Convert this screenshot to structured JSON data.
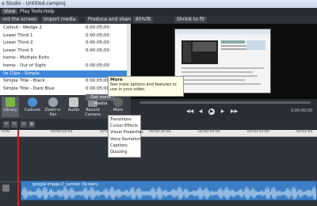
{
  "window": {
    "title": "a Studio - Untitled.camproj"
  },
  "menu": {
    "items": [
      "View",
      "Play",
      "Tools",
      "Help"
    ],
    "active_index": 0
  },
  "toolbar": {
    "record_label": "ord the screen",
    "import_label": "Import media",
    "produce_label": "Produce and share",
    "zoom_label": "85%fit",
    "size_label": "Shrink to fit"
  },
  "clips": [
    {
      "label": "Callout - Wedge 2",
      "duration": "0:00:05;00",
      "selected": false
    },
    {
      "label": "Lower Third 1",
      "duration": "0:00:05;00",
      "selected": false
    },
    {
      "label": "Lower Third 2",
      "duration": "0:00:05;00",
      "selected": false
    },
    {
      "label": "Lower Third 3",
      "duration": "0:00:05;00",
      "selected": false
    },
    {
      "label": "heme - Multiple Exits",
      "duration": "",
      "selected": false
    },
    {
      "label": "heme - Out of Sight",
      "duration": "0:00:05;00",
      "selected": false
    },
    {
      "label": "ile Clips - Simple",
      "duration": "",
      "selected": true
    },
    {
      "label": "Simple Title - Black",
      "duration": "0:00:05;00",
      "selected": false
    },
    {
      "label": "Simple Title - Dark Blue",
      "duration": "0:00:05;00",
      "selected": false
    }
  ],
  "clip_header": "",
  "tooltip": {
    "title": "More",
    "body": "See more options and features to use in your video."
  },
  "get_media_label": "Get more media",
  "tasks": [
    {
      "label": "Library",
      "icon": "library-icon",
      "selected": true
    },
    {
      "label": "Callouts",
      "icon": "callouts-icon",
      "selected": false
    },
    {
      "label": "Zoom-n-Pan",
      "icon": "zoom-icon",
      "selected": false
    },
    {
      "label": "Audio",
      "icon": "audio-icon",
      "selected": false
    },
    {
      "label": "Record Camera",
      "icon": "camera-icon",
      "selected": false
    },
    {
      "label": "More",
      "icon": "more-icon",
      "selected": false
    }
  ],
  "more_menu": [
    "Transitions",
    "Cursor Effects",
    "Visual Properties",
    "Voice Narration",
    "Captions",
    "Quizzing"
  ],
  "player": {
    "time": "0:00:00;00"
  },
  "ruler_ticks": [
    "0:00",
    "00:00:10:00",
    "00:00:20:00",
    "00:00:30:00",
    "00:00:40:00",
    "00:00:50:00",
    "00:01:00"
  ],
  "audio_clip": {
    "name": "google-image-2_camrec (Screen)"
  }
}
